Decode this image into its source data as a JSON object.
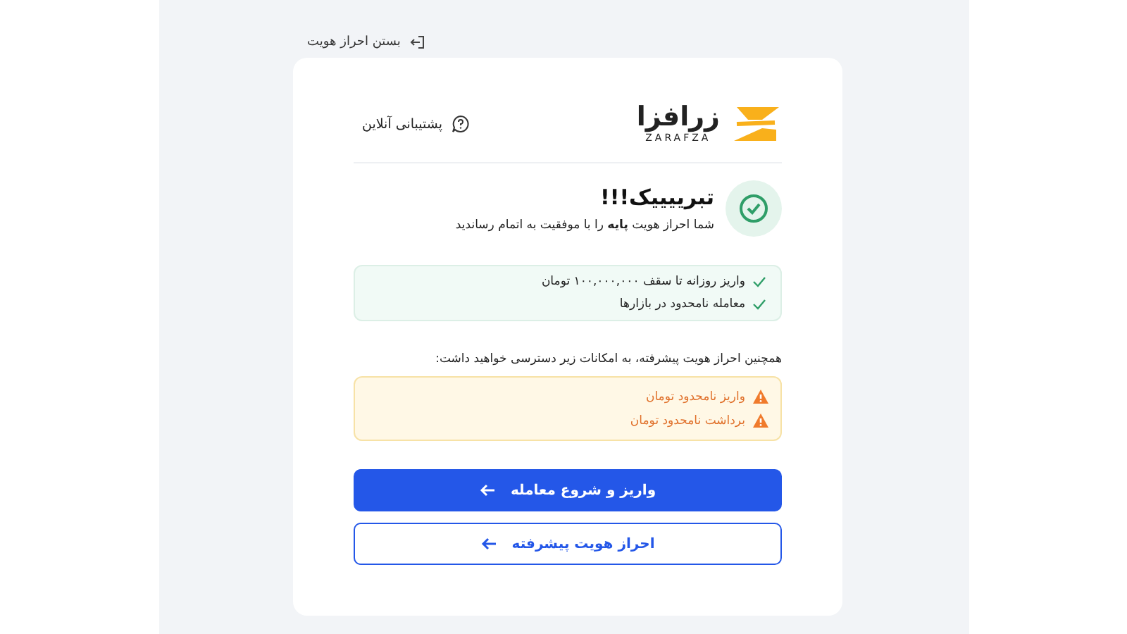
{
  "header": {
    "back_link": "بستن احراز هویت"
  },
  "card": {
    "logo": {
      "name": "زرافزا",
      "latin": "ZARAFZA"
    },
    "support": "پشتیبانی آنلاین",
    "success": {
      "title": "تبرییییک!!!",
      "subtitle": "شما احراز هویت **پایه** را با موفقیت به اتمام رساندید"
    },
    "benefits": [
      {
        "kind": "check",
        "text": "واریز روزانه تا سقف ۱۰۰,۰۰۰,۰۰۰ تومان"
      },
      {
        "kind": "check",
        "text": "معامله نامحدود در بازارها"
      }
    ],
    "advanced_note": "همچنین احراز هویت پیشرفته، به امکانات زیر دسترسی خواهید داشت:",
    "advanced_benefits": [
      {
        "kind": "warning",
        "text": "واریز نامحدود تومان"
      },
      {
        "kind": "warning",
        "text": "برداشت نامحدود تومان"
      }
    ],
    "buttons": [
      {
        "kind": "primary",
        "label": "واریز و شروع معامله"
      },
      {
        "kind": "outline",
        "label": "احراز هویت پیشرفته"
      }
    ]
  }
}
